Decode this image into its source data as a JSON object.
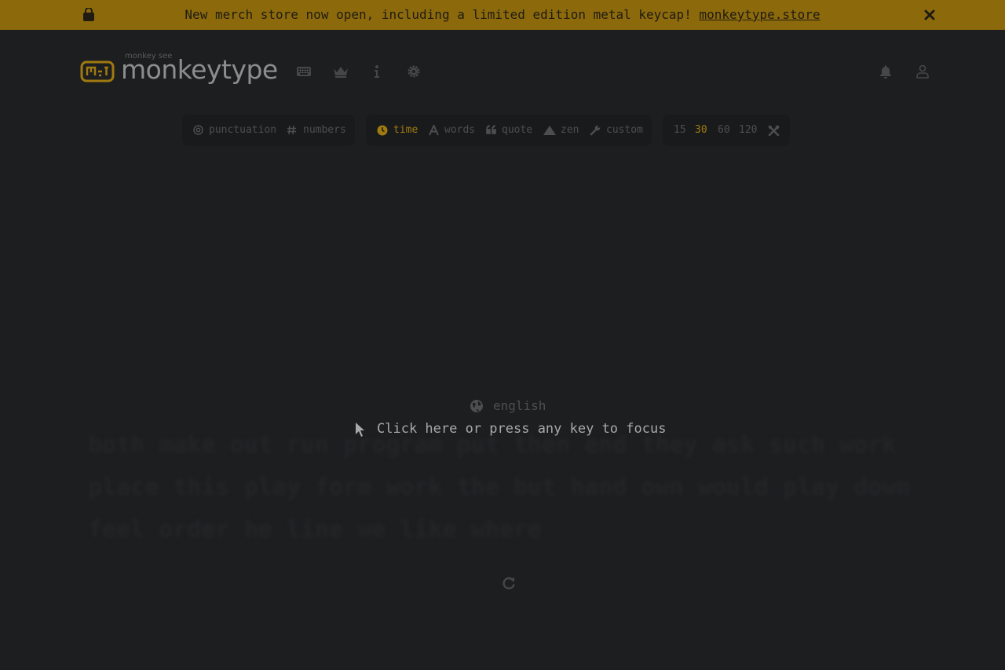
{
  "banner": {
    "message": "New merch store now open, including a limited edition metal keycap! ",
    "link": "monkeytype.store",
    "icons": [
      "shopping-bag-icon",
      "close-icon"
    ]
  },
  "header": {
    "logo_top": "monkey see",
    "logo_text": "monkeytype",
    "nav_icons": [
      "keyboard-icon",
      "crown-icon",
      "info-icon",
      "gear-icon"
    ],
    "right_icons": [
      "bell-icon",
      "user-icon"
    ]
  },
  "config": {
    "modifiers": [
      {
        "icon": "at-icon",
        "label": "punctuation"
      },
      {
        "icon": "hash-icon",
        "label": "numbers"
      }
    ],
    "modes": [
      {
        "icon": "clock-icon",
        "label": "time",
        "active": true
      },
      {
        "icon": "font-icon",
        "label": "words",
        "active": false
      },
      {
        "icon": "quote-icon",
        "label": "quote",
        "active": false
      },
      {
        "icon": "mountain-icon",
        "label": "zen",
        "active": false
      },
      {
        "icon": "wrench-icon",
        "label": "custom",
        "active": false
      }
    ],
    "durations": [
      {
        "label": "15",
        "active": false
      },
      {
        "label": "30",
        "active": true
      },
      {
        "label": "60",
        "active": false
      },
      {
        "label": "120",
        "active": false
      }
    ],
    "tools_icon": "tools-icon"
  },
  "test": {
    "language": "english",
    "focus_message": "Click here or press any key to focus",
    "words": [
      "both",
      "make",
      "out",
      "run",
      "program",
      "put",
      "then",
      "end",
      "they",
      "ask",
      "such",
      "work",
      "place",
      "this",
      "play",
      "form",
      "work",
      "the",
      "but",
      "hand",
      "own",
      "would",
      "play",
      "down",
      "feel",
      "order",
      "he",
      "line",
      "we",
      "like",
      "where"
    ]
  },
  "colors": {
    "background": "#1d1e20",
    "banner": "#8c6a0c",
    "accent": "#a07a0f",
    "sub": "#4e4e4e",
    "text": "#a8a8a8"
  }
}
